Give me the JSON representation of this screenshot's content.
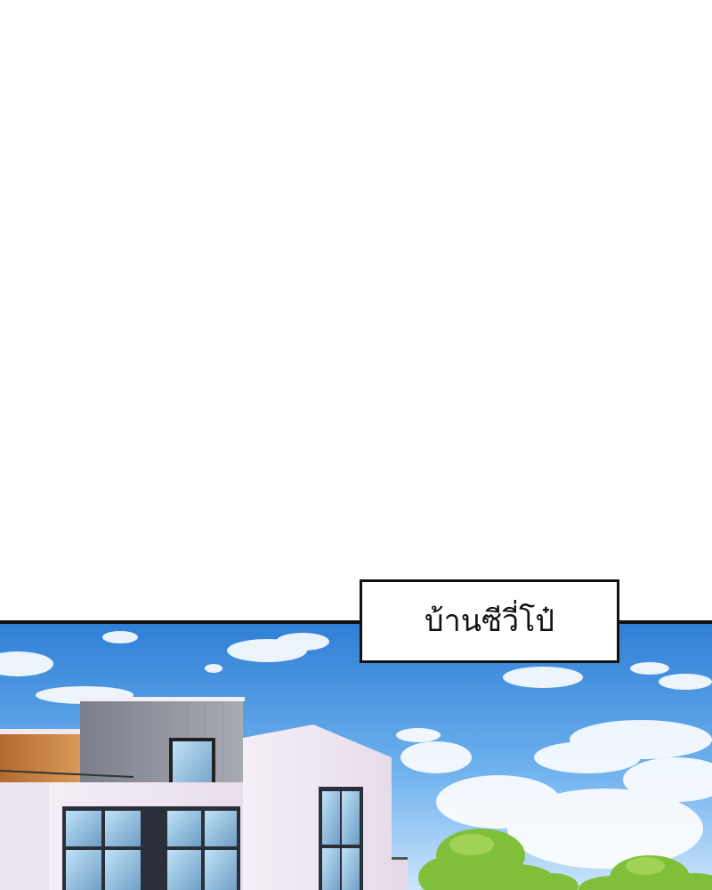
{
  "caption": {
    "text": "บ้านซีวี่โป๋"
  },
  "colors": {
    "sky_top": "#2f7fd6",
    "sky_mid": "#6fb2ee",
    "sky_bottom": "#cfe6fb",
    "outline": "#111111",
    "foliage": "#7fbf3a"
  },
  "illustration": {
    "subject": "modern-house-under-blue-sky"
  }
}
